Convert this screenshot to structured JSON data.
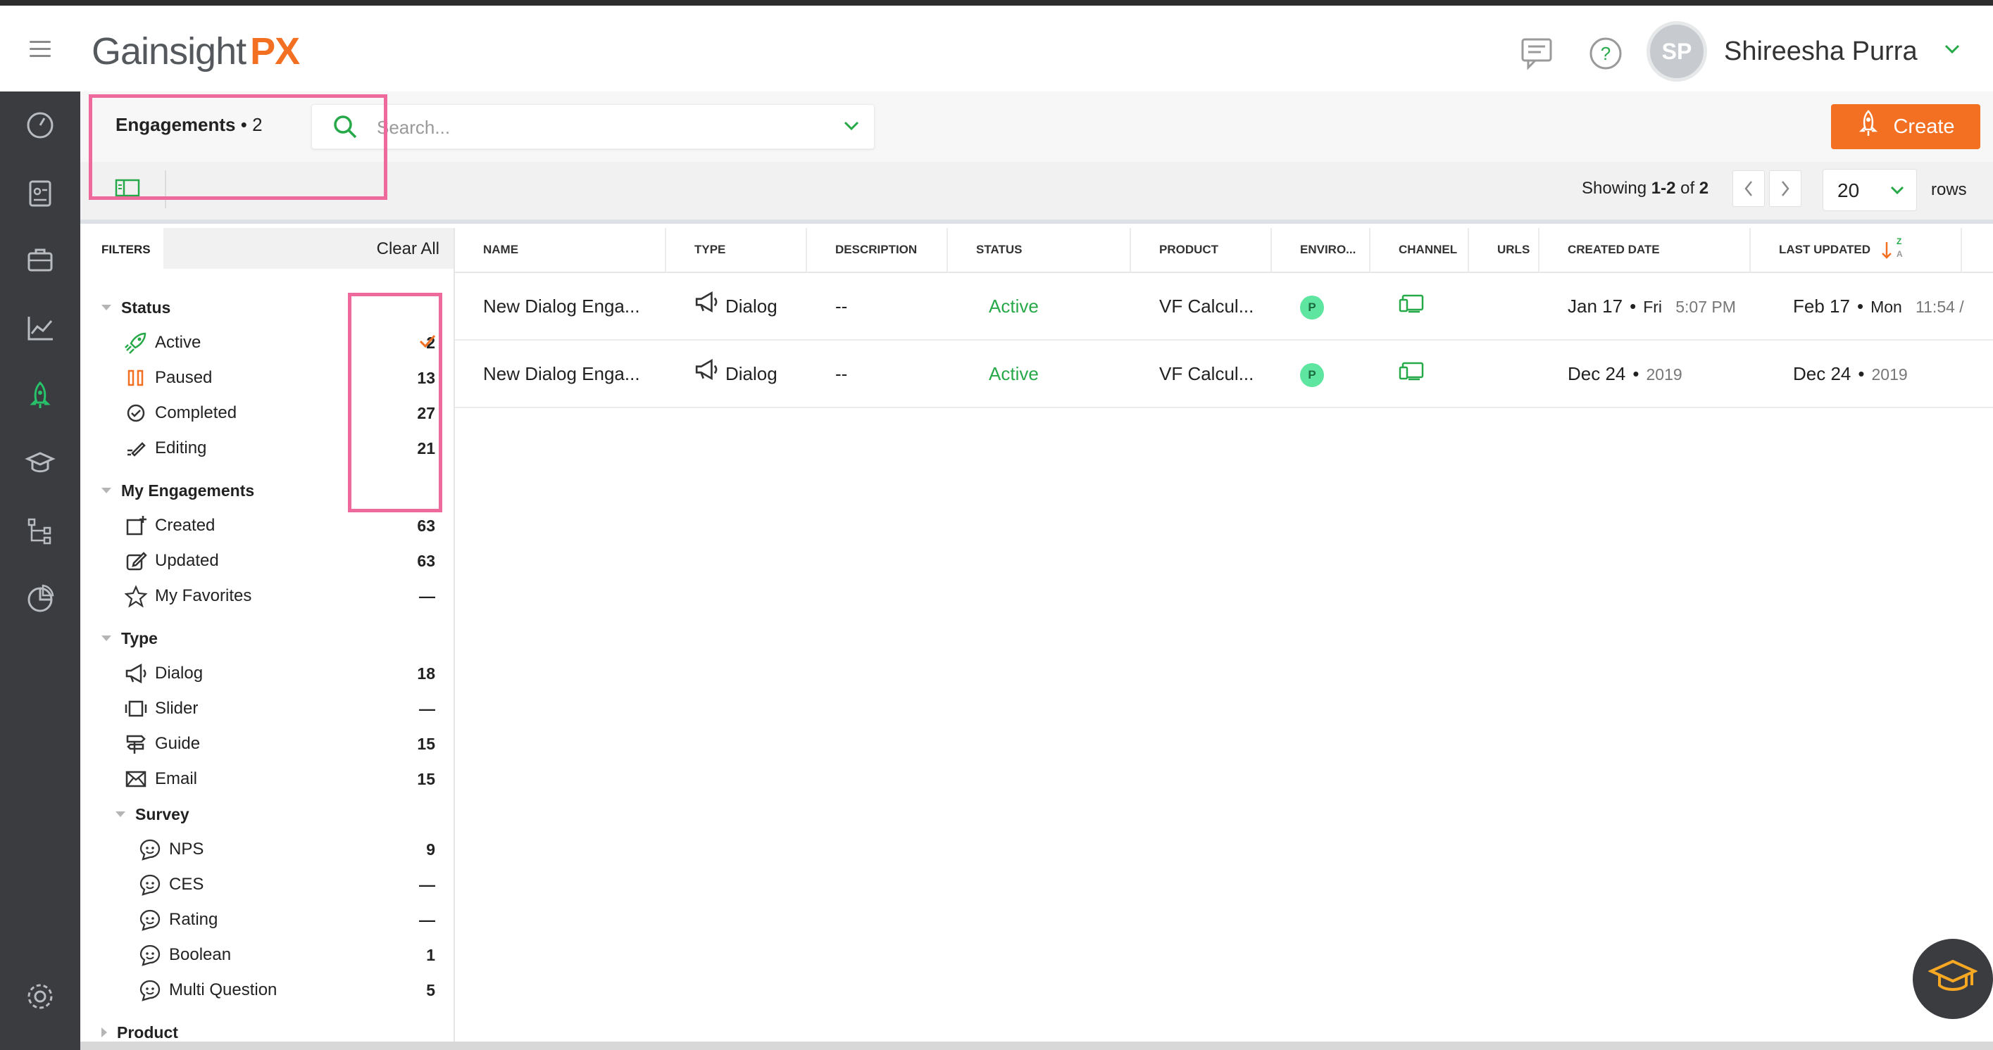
{
  "app": {
    "logo_main": "Gainsight",
    "logo_accent": "PX",
    "user_initials": "SP",
    "user_name": "Shireesha Purra"
  },
  "left_nav": [
    "dashboard-icon",
    "accounts-icon",
    "briefcase-icon",
    "analytics-icon",
    "engagements-rocket-icon",
    "knowledge-center-icon",
    "journey-orchestrator-icon",
    "reports-icon",
    "settings-icon"
  ],
  "toolbar": {
    "title": "Engagements",
    "count_sep": "•",
    "count": "2",
    "search_placeholder": "Search...",
    "create_label": "Create"
  },
  "pagination": {
    "showing_prefix": "Showing",
    "range": "1-2",
    "of": "of",
    "total": "2",
    "rows_value": "20",
    "rows_label": "rows"
  },
  "filters": {
    "tab": "FILTERS",
    "clear_all": "Clear All",
    "status": {
      "title": "Status",
      "items": [
        {
          "label": "Active",
          "count": "2"
        },
        {
          "label": "Paused",
          "count": "13"
        },
        {
          "label": "Completed",
          "count": "27"
        },
        {
          "label": "Editing",
          "count": "21"
        }
      ]
    },
    "my_engagements": {
      "title": "My Engagements",
      "items": [
        {
          "label": "Created",
          "count": "63"
        },
        {
          "label": "Updated",
          "count": "63"
        },
        {
          "label": "My Favorites",
          "count": "—"
        }
      ]
    },
    "type": {
      "title": "Type",
      "items": [
        {
          "label": "Dialog",
          "count": "18"
        },
        {
          "label": "Slider",
          "count": "—"
        },
        {
          "label": "Guide",
          "count": "15"
        },
        {
          "label": "Email",
          "count": "15"
        }
      ]
    },
    "survey": {
      "title": "Survey",
      "items": [
        {
          "label": "NPS",
          "count": "9"
        },
        {
          "label": "CES",
          "count": "—"
        },
        {
          "label": "Rating",
          "count": "—"
        },
        {
          "label": "Boolean",
          "count": "1"
        },
        {
          "label": "Multi Question",
          "count": "5"
        }
      ]
    },
    "product": {
      "title": "Product"
    }
  },
  "table": {
    "columns": [
      "NAME",
      "TYPE",
      "DESCRIPTION",
      "STATUS",
      "PRODUCT",
      "ENVIRO...",
      "CHANNEL",
      "URLS",
      "CREATED DATE",
      "LAST UPDATED"
    ],
    "sort_indicator_top": "Z",
    "sort_indicator_bottom": "A",
    "rows": [
      {
        "name": "New Dialog Enga...",
        "type": "Dialog",
        "description": "--",
        "status": "Active",
        "product": "VF Calcul...",
        "env": "P",
        "created_main": "Jan 17",
        "created_day": "Fri",
        "created_time": "5:07 PM",
        "updated_main": "Feb 17",
        "updated_day": "Mon",
        "updated_time": "11:54 /"
      },
      {
        "name": "New Dialog Enga...",
        "type": "Dialog",
        "description": "--",
        "status": "Active",
        "product": "VF Calcul...",
        "env": "P",
        "created_main": "Dec 24",
        "created_day": "",
        "created_time": "2019",
        "updated_main": "Dec 24",
        "updated_day": "",
        "updated_time": "2019"
      }
    ]
  },
  "colors": {
    "brand_orange": "#f36f21",
    "active_green": "#27a94a",
    "highlight_pink": "#ef6a9c",
    "nav_dark": "#3a3c3f"
  }
}
